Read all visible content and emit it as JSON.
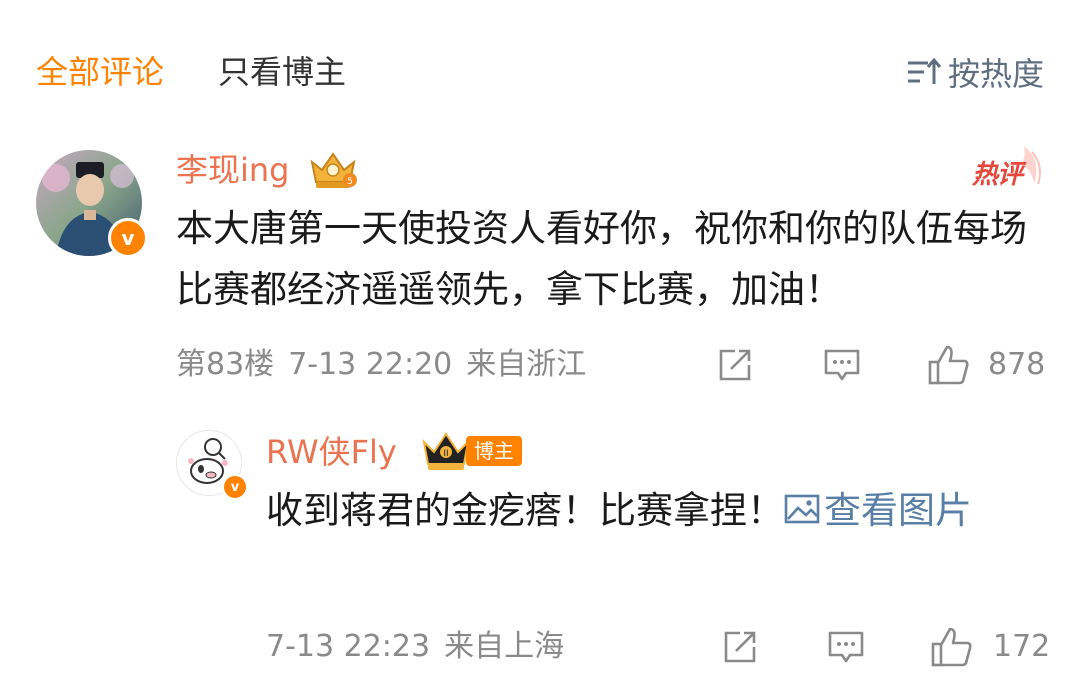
{
  "tabs": {
    "all_comments": "全部评论",
    "blogger_only": "只看博主",
    "sort_label": "按热度",
    "sort_icon": "sort-icon"
  },
  "comment": {
    "username": "李现ing",
    "badge_icon": "crown-icon",
    "hot_label": "热评",
    "text": "本大唐第一天使投资人看好你，祝你和你的队伍每场比赛都经济遥遥领先，拿下比赛，加油！",
    "floor": "第83楼",
    "time": "7-13 22:20",
    "location": "来自浙江",
    "likes": "878",
    "verified_mark": "v"
  },
  "reply": {
    "username": "RW侠Fly",
    "badge_icon": "crown-icon",
    "role_badge": "博主",
    "text": "收到蒋君的金疙瘩！比赛拿捏！",
    "view_image": "查看图片",
    "time": "7-13 22:23",
    "location": "来自上海",
    "likes": "172",
    "verified_mark": "v"
  },
  "colors": {
    "accent_orange": "#ff8200",
    "username": "#eb7350",
    "link_blue": "#5a7fa6",
    "meta_gray": "#8a8a8a",
    "hot_red": "#e5473c"
  }
}
